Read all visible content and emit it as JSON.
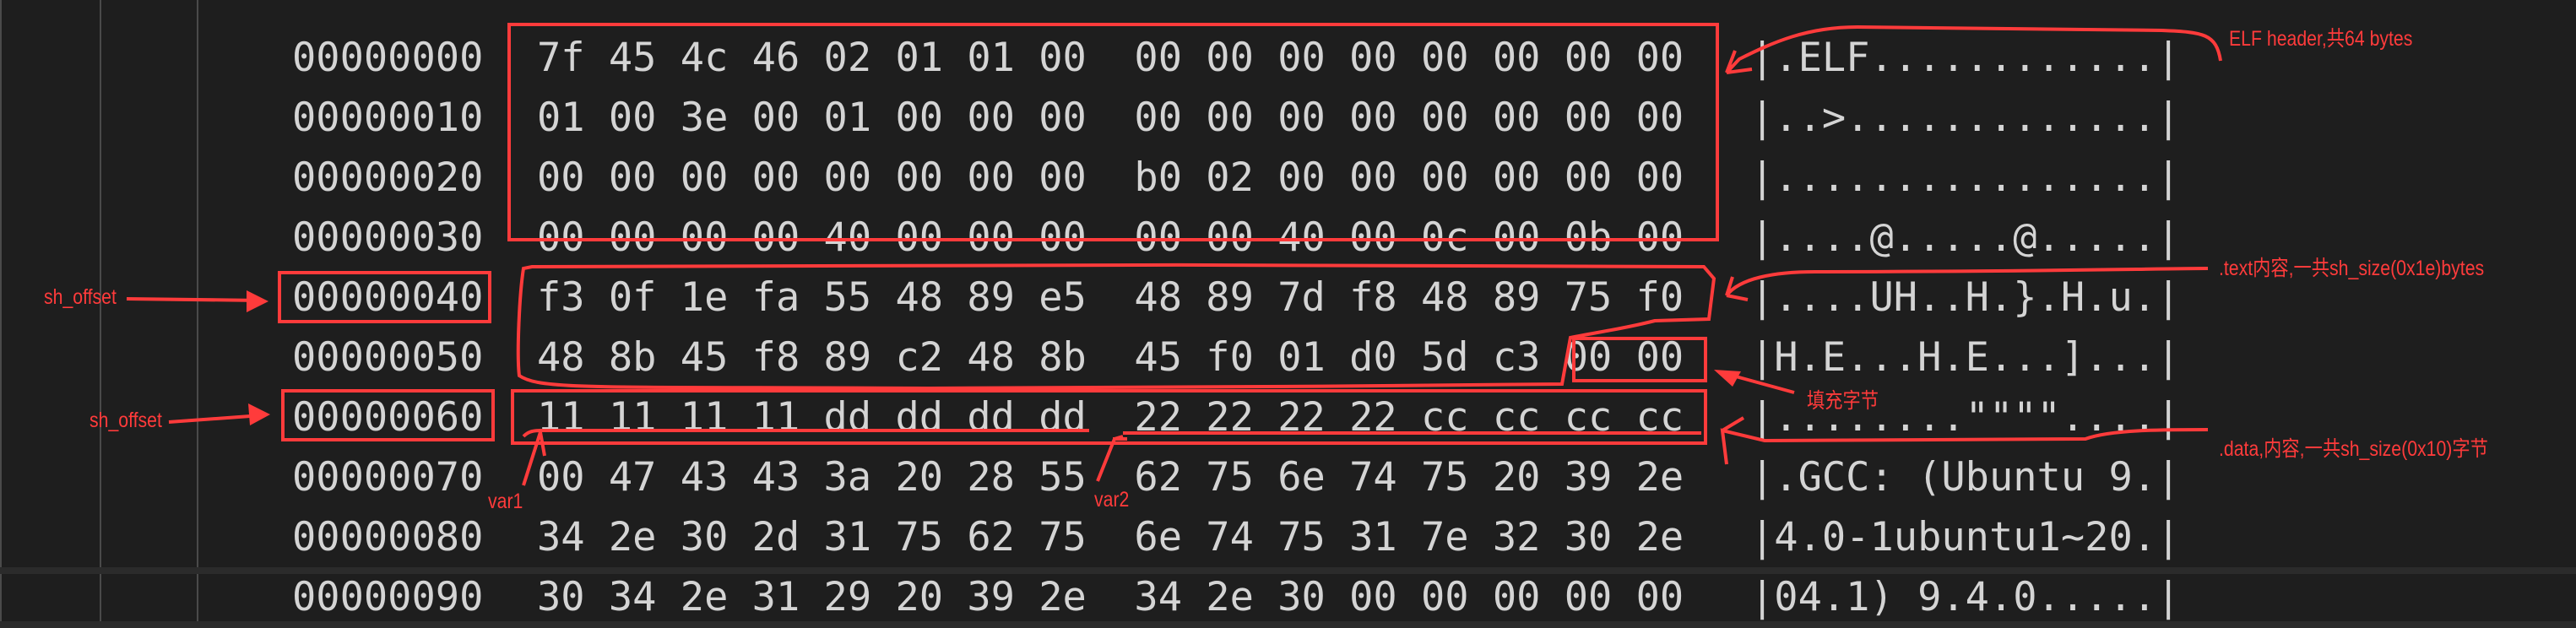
{
  "rows": [
    {
      "offset": "00000000",
      "hex": "7f 45 4c 46 02 01 01 00  00 00 00 00 00 00 00 00",
      "ascii": "|.ELF............|"
    },
    {
      "offset": "00000010",
      "hex": "01 00 3e 00 01 00 00 00  00 00 00 00 00 00 00 00",
      "ascii": "|..>.............|"
    },
    {
      "offset": "00000020",
      "hex": "00 00 00 00 00 00 00 00  b0 02 00 00 00 00 00 00",
      "ascii": "|................|"
    },
    {
      "offset": "00000030",
      "hex": "00 00 00 00 40 00 00 00  00 00 40 00 0c 00 0b 00",
      "ascii": "|....@.....@.....|"
    },
    {
      "offset": "00000040",
      "hex": "f3 0f 1e fa 55 48 89 e5  48 89 7d f8 48 89 75 f0",
      "ascii": "|....UH..H.}.H.u.|"
    },
    {
      "offset": "00000050",
      "hex": "48 8b 45 f8 89 c2 48 8b  45 f0 01 d0 5d c3 00 00",
      "ascii": "|H.E...H.E...]...|"
    },
    {
      "offset": "00000060",
      "hex": "11 11 11 11 dd dd dd dd  22 22 22 22 cc cc cc cc",
      "ascii": "|........\"\"\"\"....|"
    },
    {
      "offset": "00000070",
      "hex": "00 47 43 43 3a 20 28 55  62 75 6e 74 75 20 39 2e",
      "ascii": "|.GCC: (Ubuntu 9.|"
    },
    {
      "offset": "00000080",
      "hex": "34 2e 30 2d 31 75 62 75  6e 74 75 31 7e 32 30 2e",
      "ascii": "|4.0-1ubuntu1~20.|"
    },
    {
      "offset": "00000090",
      "hex": "30 34 2e 31 29 20 39 2e  34 2e 30 00 00 00 00 00",
      "ascii": "|04.1) 9.4.0.....|"
    }
  ],
  "annotations": {
    "elf_header": "ELF header,共64 bytes",
    "text_section": ".text内容,一共sh_size(0x1e)bytes",
    "padding": "填充字节",
    "data_section": ".data,内容,一共sh_size(0x10)字节",
    "sh_offset_1": "sh_offset",
    "sh_offset_2": "sh_offset",
    "var1": "var1",
    "var2": "var2"
  },
  "colors": {
    "background": "#1e1e1e",
    "text": "#d4d4d4",
    "annotation": "#ff3b3b"
  }
}
